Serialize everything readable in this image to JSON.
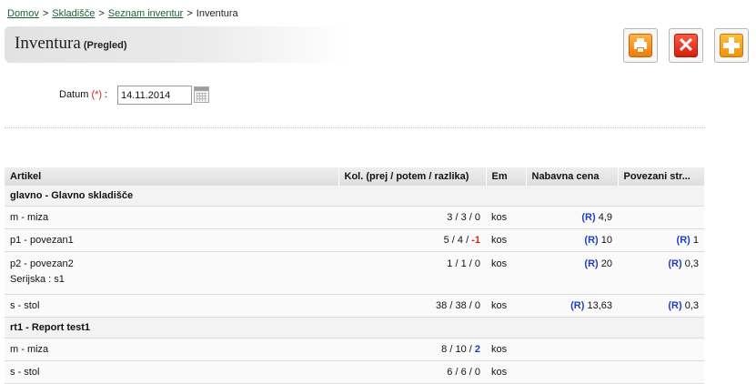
{
  "breadcrumb": {
    "items": [
      "Domov",
      "Skladišče",
      "Seznam inventur"
    ],
    "current": "Inventura",
    "separator": ">"
  },
  "header": {
    "title": "Inventura",
    "subtitle": "(Pregled)"
  },
  "toolbar": {
    "print_icon": "printer-icon",
    "close_icon": "close-icon",
    "add_icon": "plus-icon"
  },
  "date": {
    "label": "Datum",
    "required_mark": "(*)",
    "colon": ":",
    "value": "14.11.2014",
    "calendar_icon": "calendar-icon"
  },
  "table": {
    "columns": [
      "Artikel",
      "Kol. (prej / potem / razlika)",
      "Em",
      "Nabavna cena",
      "Povezani str..."
    ],
    "groups": [
      {
        "name": "glavno - Glavno skladišče",
        "rows": [
          {
            "article": "m - miza",
            "qty_before": "3",
            "qty_after": "3",
            "qty_diff": "0",
            "unit": "kos",
            "price_tag": "(R)",
            "price": "4,9",
            "linked_tag": "",
            "linked": ""
          },
          {
            "article": "p1 - povezan1",
            "qty_before": "5",
            "qty_after": "4",
            "qty_diff": "-1",
            "unit": "kos",
            "price_tag": "(R)",
            "price": "10",
            "linked_tag": "(R)",
            "linked": "1"
          },
          {
            "article": "p2 - povezan2",
            "serial": "Serijska : s1",
            "qty_before": "1",
            "qty_after": "1",
            "qty_diff": "0",
            "unit": "kos",
            "price_tag": "(R)",
            "price": "20",
            "linked_tag": "(R)",
            "linked": "0,3"
          },
          {
            "article": "s - stol",
            "qty_before": "38",
            "qty_after": "38",
            "qty_diff": "0",
            "unit": "kos",
            "price_tag": "(R)",
            "price": "13,63",
            "linked_tag": "(R)",
            "linked": "0,3"
          }
        ]
      },
      {
        "name": "rt1 - Report test1",
        "rows": [
          {
            "article": "m - miza",
            "qty_before": "8",
            "qty_after": "10",
            "qty_diff": "2",
            "unit": "kos",
            "price_tag": "",
            "price": "",
            "linked_tag": "",
            "linked": ""
          },
          {
            "article": "s - stol",
            "qty_before": "6",
            "qty_after": "6",
            "qty_diff": "0",
            "unit": "kos",
            "price_tag": "",
            "price": "",
            "linked_tag": "",
            "linked": ""
          }
        ]
      }
    ]
  },
  "colors": {
    "link": "#1f5f33",
    "tag_blue": "#1f3fbf",
    "negative_red": "#d9261c",
    "required_red": "#d9261c"
  }
}
